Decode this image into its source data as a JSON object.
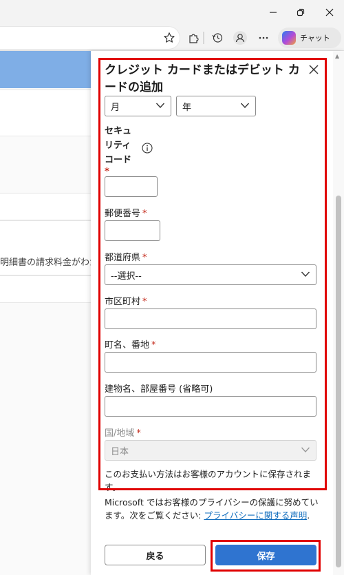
{
  "browser": {
    "chat_label": "チャット",
    "minimize_icon": "minimize-icon",
    "restore_icon": "restore-icon",
    "close_icon": "close-icon"
  },
  "background_page": {
    "partial_text": "明細書の請求料金がわか"
  },
  "dialog": {
    "title": "クレジット カードまたはデビット カードの追加",
    "expiry": {
      "month_value": "月",
      "year_value": "年"
    },
    "security_code": {
      "label_line1": "セキュ",
      "label_line2": "リティ",
      "label_line3": "コード",
      "required_mark": "*"
    },
    "postal_code": {
      "label": "郵便番号",
      "required_mark": "*",
      "value": ""
    },
    "prefecture": {
      "label": "都道府県",
      "required_mark": "*",
      "value": "--選択--"
    },
    "city": {
      "label": "市区町村",
      "required_mark": "*",
      "value": ""
    },
    "street": {
      "label": "町名、番地",
      "required_mark": "*",
      "value": ""
    },
    "building": {
      "label": "建物名、部屋番号 (省略可)",
      "value": ""
    },
    "country": {
      "label": "国/地域",
      "required_mark": "*",
      "value": "日本"
    },
    "save_note": "このお支払い方法はお客様のアカウントに保存されます。",
    "privacy_text": "Microsoft ではお客様のプライバシーの保護に努めています。次をご覧ください: ",
    "privacy_link": "プライバシーに関する声明",
    "privacy_end": ".",
    "back_button": "戻る",
    "save_button": "保存"
  },
  "colors": {
    "accent": "#2f74d0",
    "highlight": "#e00000",
    "required": "#c42b1c"
  }
}
